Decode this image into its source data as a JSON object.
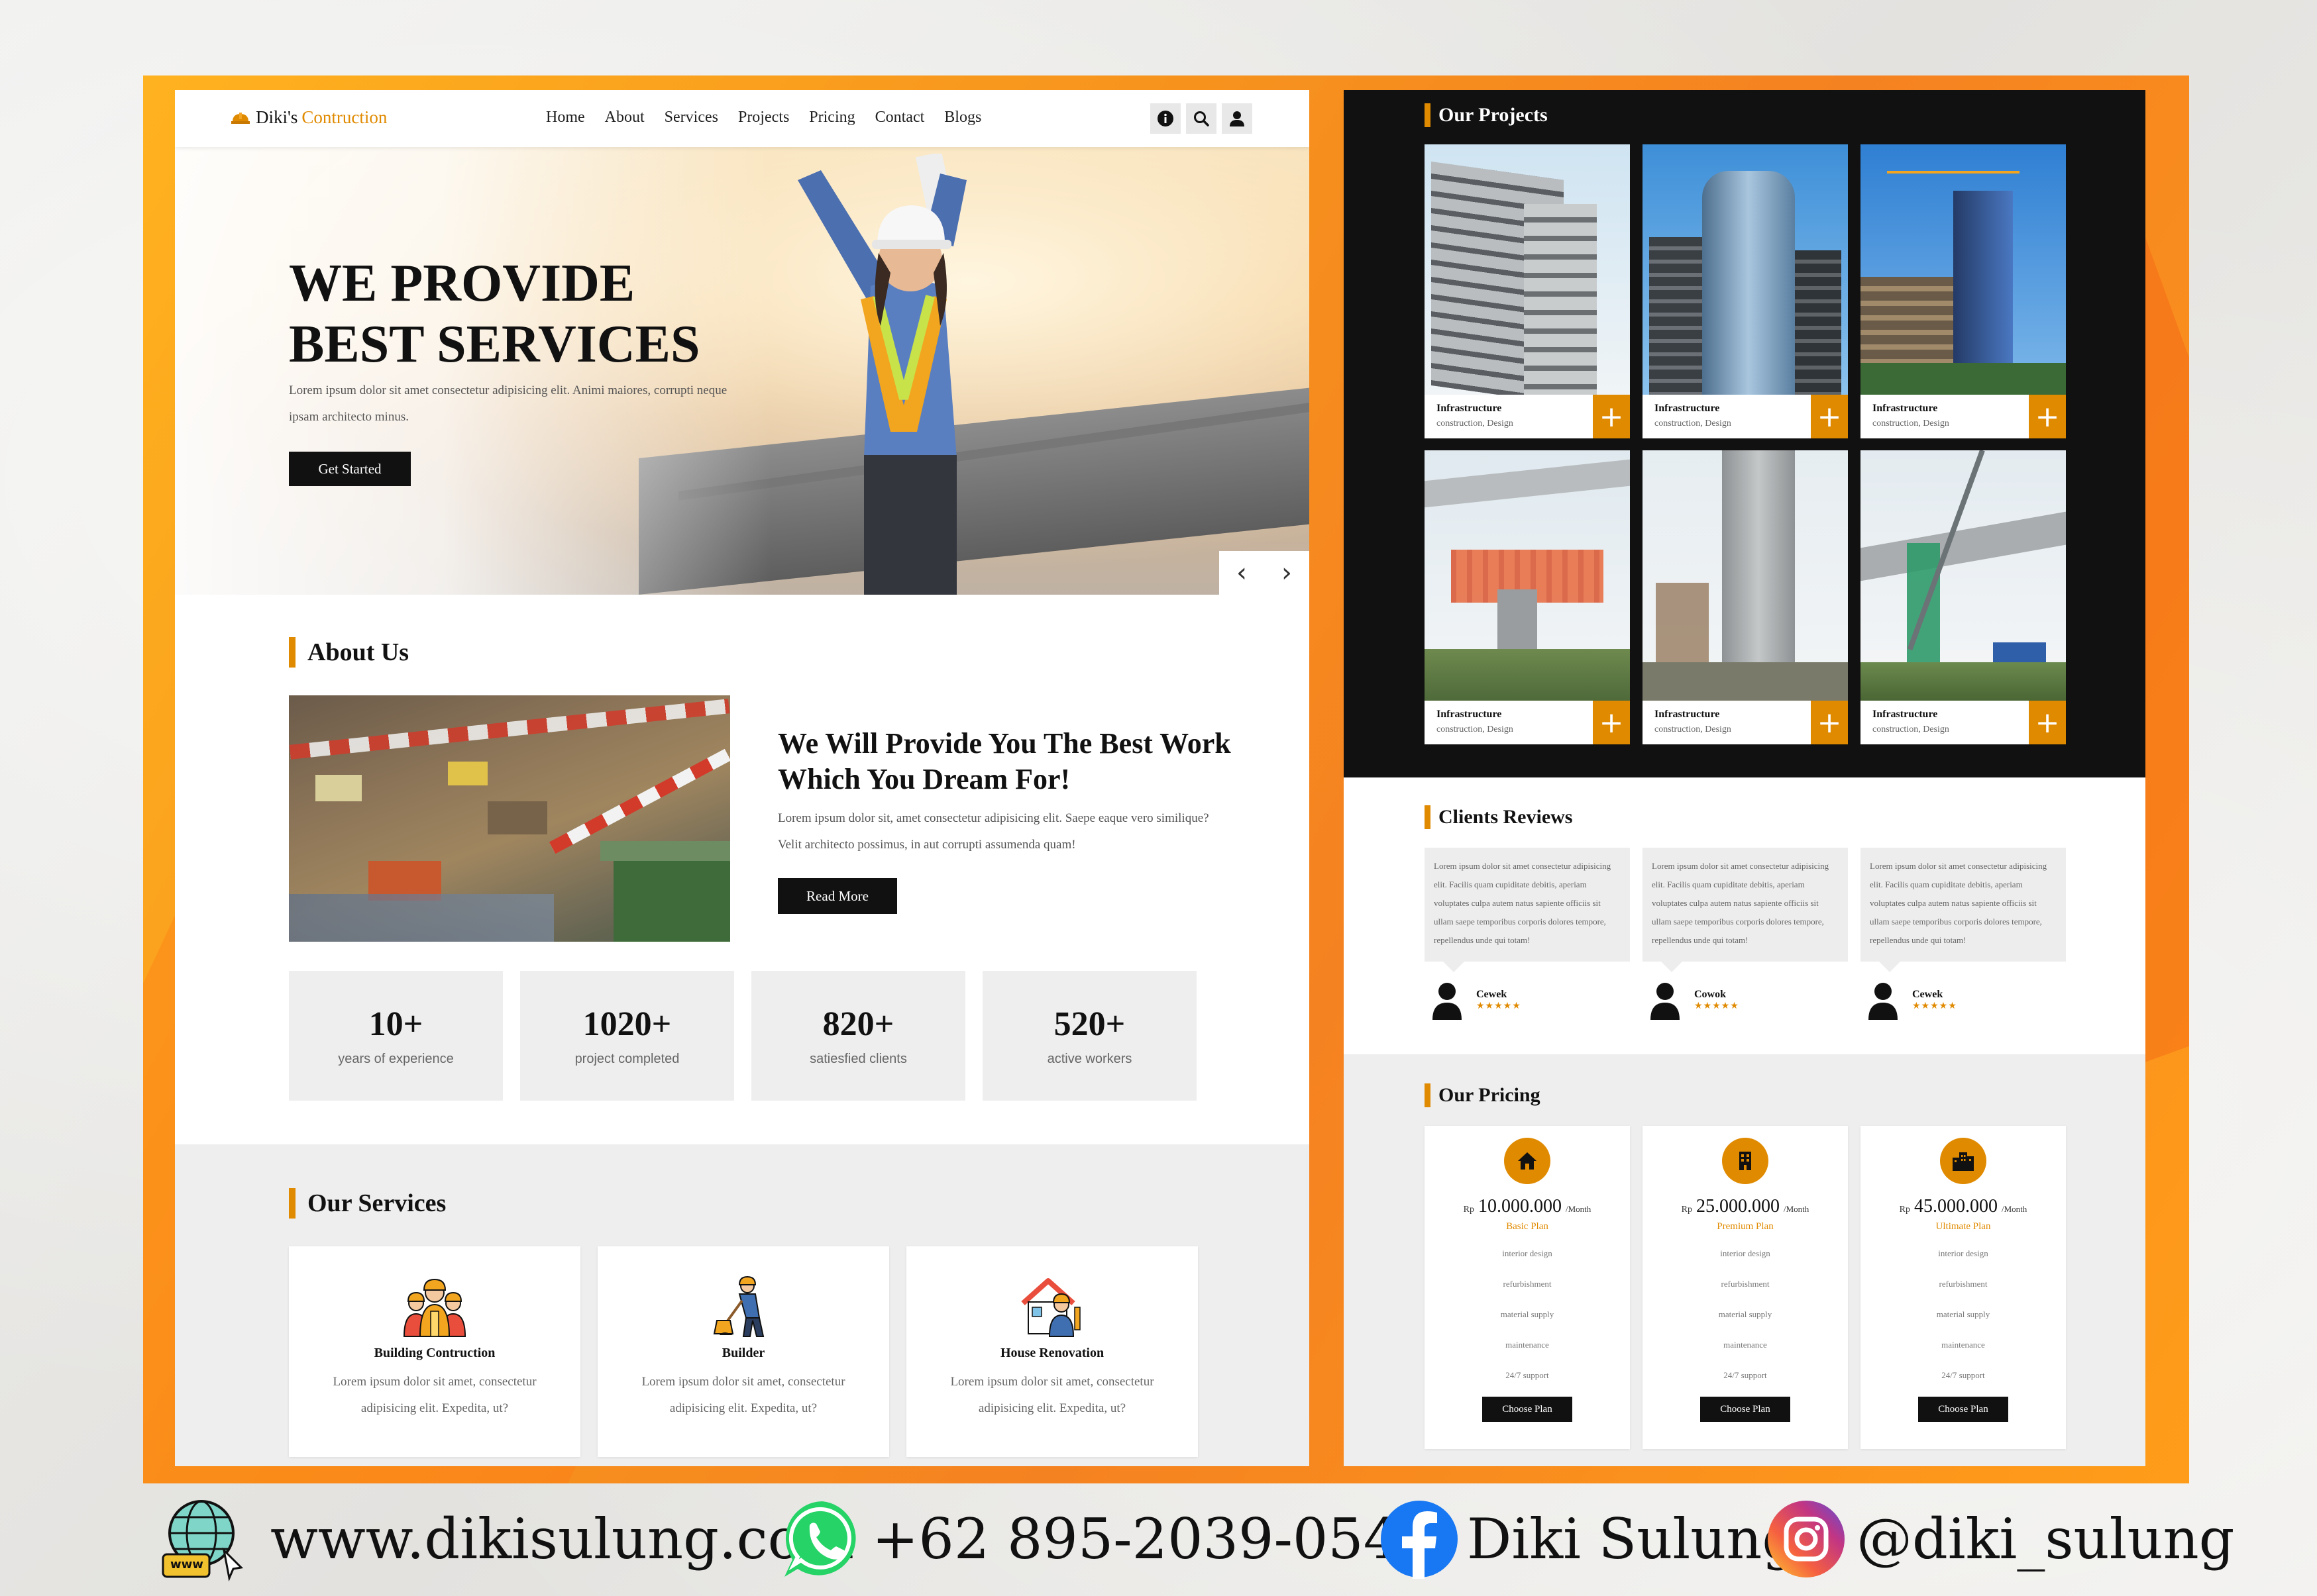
{
  "colors": {
    "accent": "#e08a00",
    "frame": "#f7941d",
    "dark": "#111111",
    "light_gray": "#eeeeee"
  },
  "nav": {
    "brand_part1": "Diki's",
    "brand_part2": "Contruction",
    "items": [
      "Home",
      "About",
      "Services",
      "Projects",
      "Pricing",
      "Contact",
      "Blogs"
    ],
    "icons": [
      "info-icon",
      "search-icon",
      "user-icon"
    ]
  },
  "hero": {
    "title": "WE PROVIDE\nBEST SERVICES",
    "text": "Lorem ipsum dolor sit amet consectetur adipisicing elit. Animi maiores, corrupti neque ipsam architecto minus.",
    "button": "Get Started",
    "prev": "‹",
    "next": "›"
  },
  "about": {
    "section_title": "About Us",
    "heading": "We Will Provide You The Best Work Which You Dream For!",
    "text": "Lorem ipsum dolor sit, amet consectetur adipisicing elit. Saepe eaque vero similique? Velit architecto possimus, in aut corrupti assumenda quam!",
    "button": "Read More"
  },
  "stats": [
    {
      "value": "10+",
      "label": "years of experience"
    },
    {
      "value": "1020+",
      "label": "project completed"
    },
    {
      "value": "820+",
      "label": "satiesfied clients"
    },
    {
      "value": "520+",
      "label": "active workers"
    }
  ],
  "services": {
    "section_title": "Our Services",
    "items": [
      {
        "name": "Building Contruction",
        "desc": "Lorem ipsum dolor sit amet, consectetur adipisicing elit. Expedita, ut?",
        "icon": "workers-icon"
      },
      {
        "name": "Builder",
        "desc": "Lorem ipsum dolor sit amet, consectetur adipisicing elit. Expedita, ut?",
        "icon": "builder-icon"
      },
      {
        "name": "House Renovation",
        "desc": "Lorem ipsum dolor sit amet, consectetur adipisicing elit. Expedita, ut?",
        "icon": "house-renovation-icon"
      }
    ]
  },
  "projects": {
    "section_title": "Our Projects",
    "items": [
      {
        "name": "Infrastructure",
        "tags": "construction, Design"
      },
      {
        "name": "Infrastructure",
        "tags": "construction, Design"
      },
      {
        "name": "Infrastructure",
        "tags": "construction, Design"
      },
      {
        "name": "Infrastructure",
        "tags": "construction, Design"
      },
      {
        "name": "Infrastructure",
        "tags": "construction, Design"
      },
      {
        "name": "Infrastructure",
        "tags": "construction, Design"
      }
    ],
    "plus": "+"
  },
  "reviews": {
    "section_title": "Clients Reviews",
    "items": [
      {
        "text": "Lorem ipsum dolor sit amet consectetur adipisicing elit. Facilis quam cupiditate debitis, aperiam voluptates culpa autem natus sapiente officiis sit ullam saepe temporibus corporis dolores tempore, repellendus unde qui totam!",
        "name": "Cewek",
        "stars": "★★★★★"
      },
      {
        "text": "Lorem ipsum dolor sit amet consectetur adipisicing elit. Facilis quam cupiditate debitis, aperiam voluptates culpa autem natus sapiente officiis sit ullam saepe temporibus corporis dolores tempore, repellendus unde qui totam!",
        "name": "Cowok",
        "stars": "★★★★★"
      },
      {
        "text": "Lorem ipsum dolor sit amet consectetur adipisicing elit. Facilis quam cupiditate debitis, aperiam voluptates culpa autem natus sapiente officiis sit ullam saepe temporibus corporis dolores tempore, repellendus unde qui totam!",
        "name": "Cewek",
        "stars": "★★★★★"
      }
    ]
  },
  "pricing": {
    "section_title": "Our Pricing",
    "plans": [
      {
        "currency": "Rp",
        "amount": "10.000.000",
        "period": "/Month",
        "name": "Basic Plan",
        "icon": "home-icon",
        "features": [
          "interior design",
          "refurbishment",
          "material supply",
          "maintenance",
          "24/7 support"
        ],
        "button": "Choose Plan"
      },
      {
        "currency": "Rp",
        "amount": "25.000.000",
        "period": "/Month",
        "name": "Premium Plan",
        "icon": "building-icon",
        "features": [
          "interior design",
          "refurbishment",
          "material supply",
          "maintenance",
          "24/7 support"
        ],
        "button": "Choose Plan"
      },
      {
        "currency": "Rp",
        "amount": "45.000.000",
        "period": "/Month",
        "name": "Ultimate Plan",
        "icon": "city-icon",
        "features": [
          "interior design",
          "refurbishment",
          "material supply",
          "maintenance",
          "24/7 support"
        ],
        "button": "Choose Plan"
      }
    ]
  },
  "footer": {
    "website": "www.dikisulung.com",
    "website_badge": "www",
    "phone": "+62 895-2039-0548",
    "facebook": "Diki Sulung",
    "instagram": "@diki_sulung"
  }
}
